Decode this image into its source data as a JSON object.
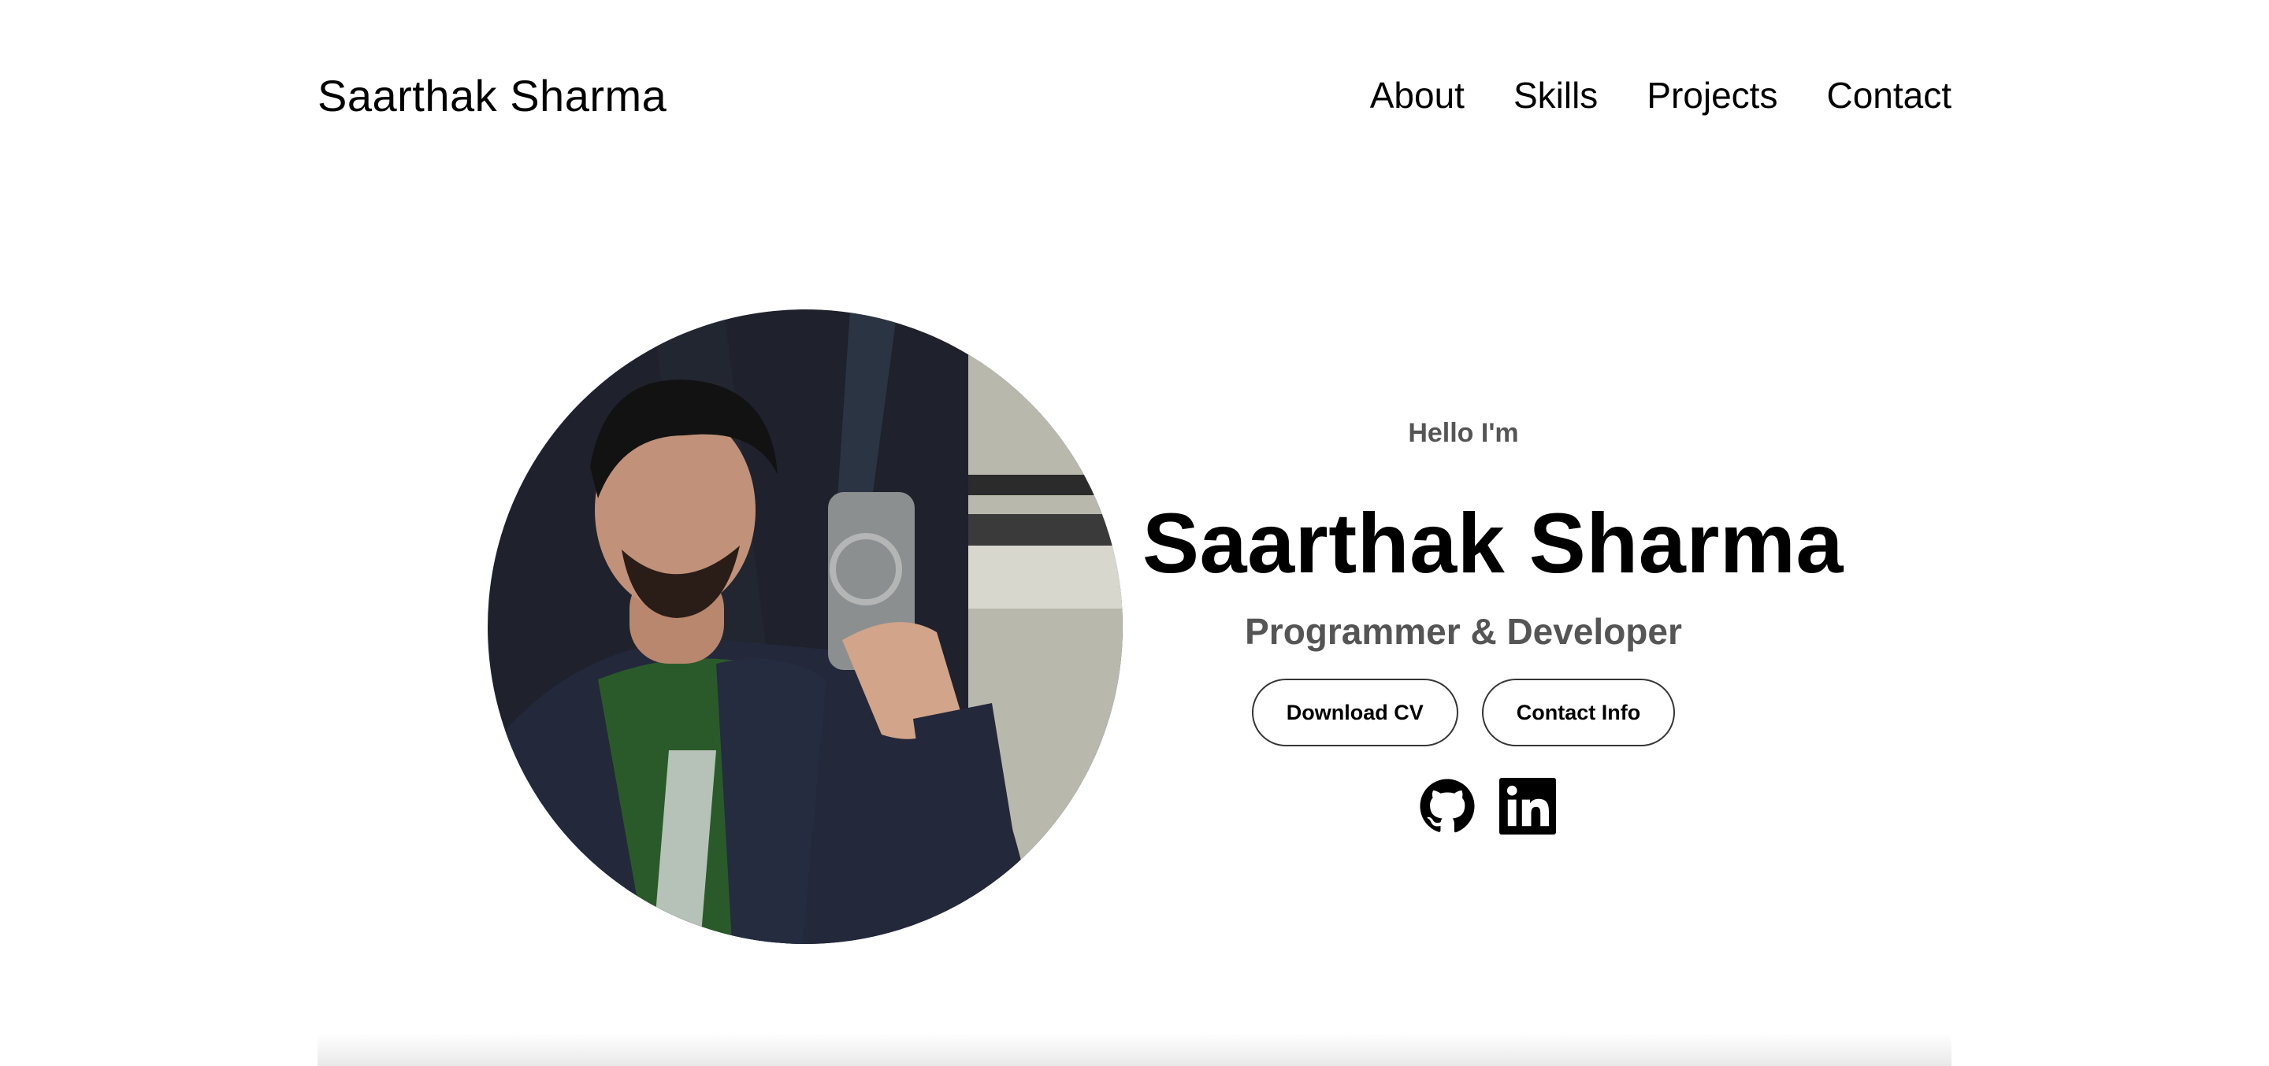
{
  "nav": {
    "logo": "Saarthak Sharma",
    "links": [
      "About",
      "Skills",
      "Projects",
      "Contact"
    ]
  },
  "hero": {
    "greeting": "Hello I'm",
    "name": "Saarthak Sharma",
    "role": "Programmer & Developer",
    "buttons": {
      "download_cv": "Download CV",
      "contact_info": "Contact Info"
    },
    "photo_alt": "profile-photo",
    "socials": [
      "github-icon",
      "linkedin-icon"
    ]
  },
  "colors": {
    "text": "#000000",
    "muted": "#555555",
    "button_border": "#353535",
    "background": "#ffffff"
  }
}
